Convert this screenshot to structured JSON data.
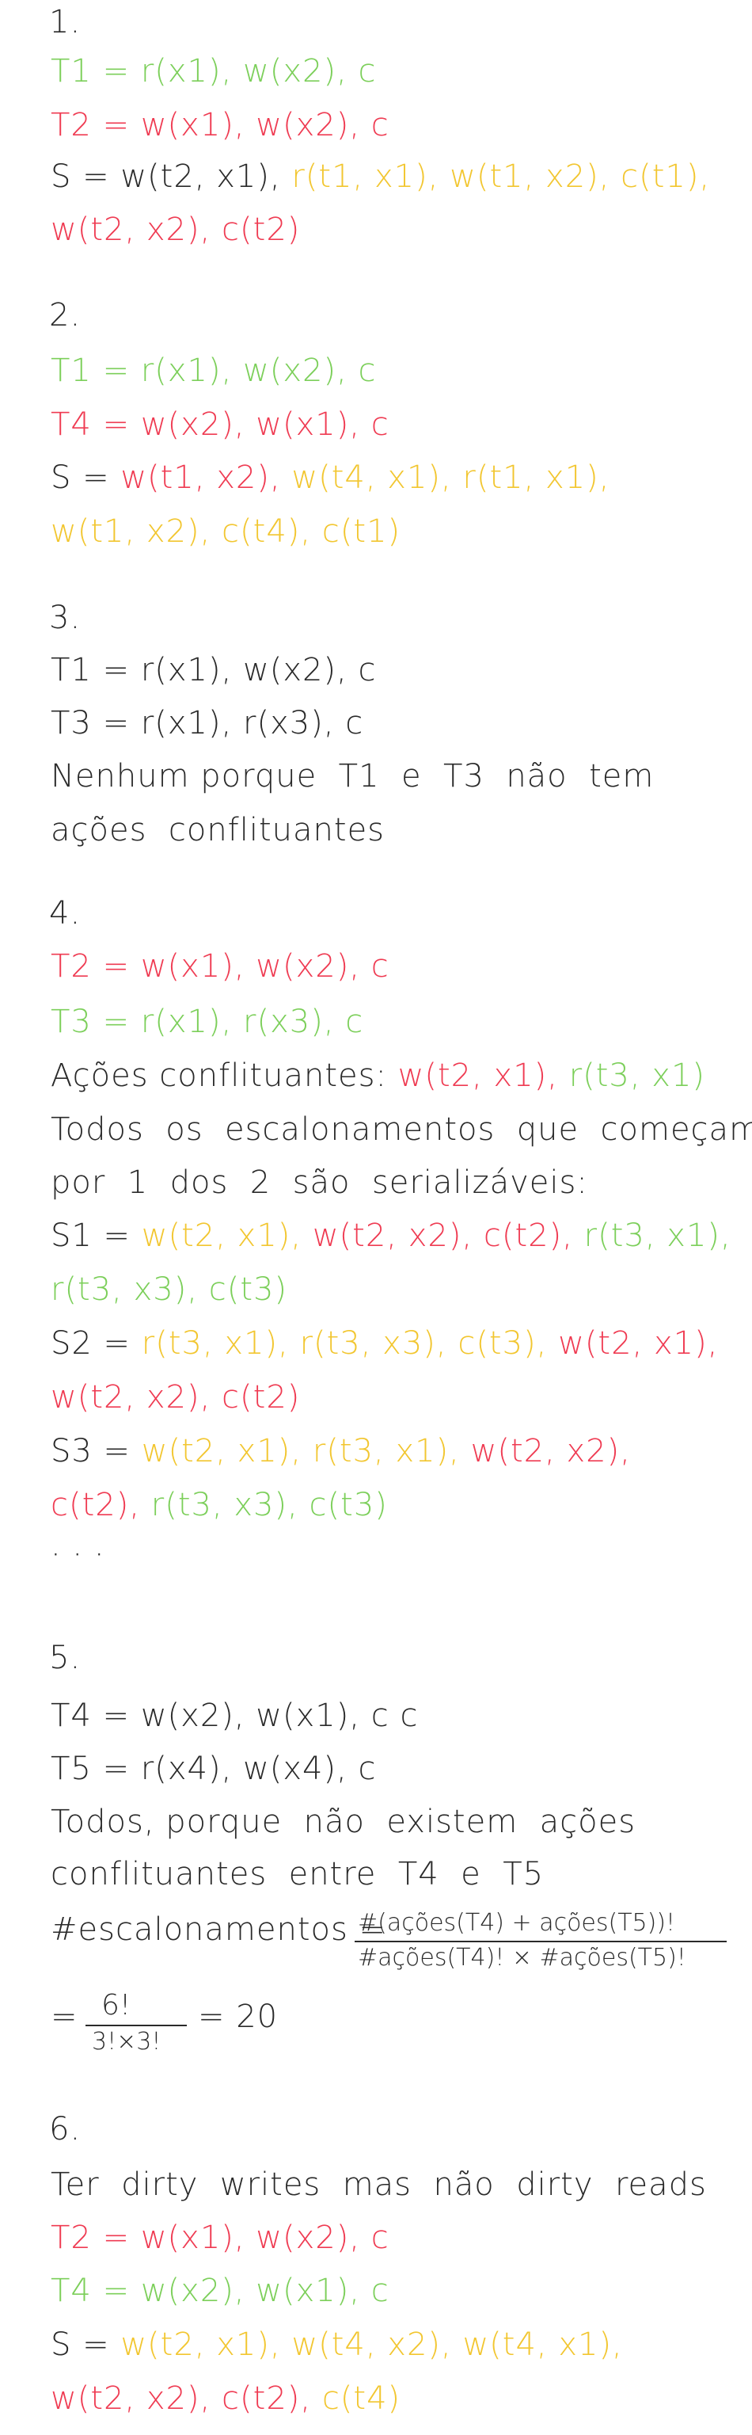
{
  "q1": {
    "num": "1.",
    "t1": "T1 = r(x1), w(x2), c",
    "t2": "T2 = w(x1), w(x2), c",
    "s_a": "S = w(t2, x1), ",
    "s_b": "r(t1, x1), w(t1, x2), c(t1),",
    "s_c": "w(t2, x2), c(t2)"
  },
  "q2": {
    "num": "2.",
    "t1": "T1 = r(x1), w(x2), c",
    "t4": "T4 = w(x2), w(x1), c",
    "s_a": "S = ",
    "s_b": "w(t1, x2), ",
    "s_c": "w(t4, x1), r(t1, x1),",
    "s_d": "w(t1, x2), c(t4), c(t1)"
  },
  "q3": {
    "num": "3.",
    "t1": "T1 = r(x1), w(x2), c",
    "t3": "T3 = r(x1), r(x3), c",
    "ans1": "Nenhum porque  T1  e  T3  não  tem",
    "ans2": "ações  conflituantes"
  },
  "q4": {
    "num": "4.",
    "t2": "T2 = w(x1), w(x2), c",
    "t3": "T3 = r(x1), r(x3), c",
    "conf_a": "Ações conflituantes: ",
    "conf_b": "w(t2, x1), ",
    "conf_c": "r(t3, x1)",
    "all1": "Todos  os  escalonamentos  que  começam",
    "all2": "por  1  dos  2  são  serializáveis:",
    "s1_a": "S1 = ",
    "s1_b": "w(t2, x1), ",
    "s1_c": "w(t2, x2), c(t2), ",
    "s1_d": "r(t3, x1),",
    "s1_e": "r(t3, x3), c(t3)",
    "s2_a": "S2 = ",
    "s2_b": "r(t3, x1), r(t3, x3), c(t3), ",
    "s2_c": "w(t2, x1),",
    "s2_d": "w(t2, x2), c(t2)",
    "s3_a": "S3 = ",
    "s3_b": "w(t2, x1), ",
    "s3_c": "r(t3, x1), ",
    "s3_d": "w(t2, x2),",
    "s3_e": "c(t2), ",
    "s3_f": "r(t3, x3), c(t3)",
    "dots": "· · ·"
  },
  "q5": {
    "num": "5.",
    "t4": "T4 = w(x2), w(x1), c c",
    "t5": "T5 = r(x4), w(x4), c",
    "all1": "Todos, porque  não  existem  ações",
    "all2": "conflituantes  entre  T4  e  T5",
    "esc": "#escalonamentos =",
    "numer": "#(ações(T4) + ações(T5))!",
    "denom": "#ações(T4)! × #ações(T5)!",
    "eq": "=",
    "fnum": "6!",
    "fden": "3!×3!",
    "res": "= 20"
  },
  "q6": {
    "num": "6.",
    "desc": "Ter  dirty  writes  mas  não  dirty  reads",
    "t2": "T2 = w(x1), w(x2), c",
    "t4": "T4 = w(x2), w(x1), c",
    "s_a": "S = ",
    "s_b": "w(t2, x1), ",
    "s_c": "w(t4, x2), ",
    "s_d": "w(t4, x1),",
    "s_e": "w(t2, x2), c(t2), ",
    "s_f": "c(t4)"
  }
}
